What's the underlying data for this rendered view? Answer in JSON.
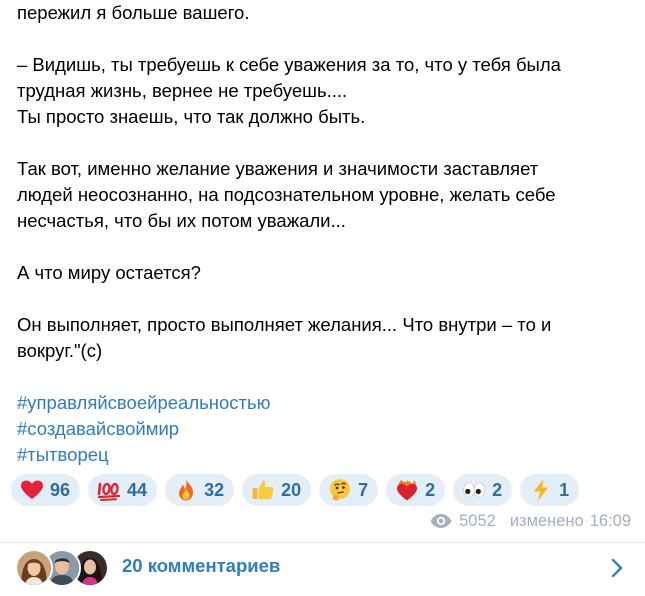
{
  "post": {
    "paragraphs": [
      [
        "пережил я больше вашего."
      ],
      [
        "– Видишь, ты требуешь к себе уважения за то, что у тебя была",
        "трудная жизнь, вернее не требуешь....",
        "Ты просто знаешь, что так должно быть."
      ],
      [
        "Так вот, именно желание уважения и значимости заставляет",
        "людей неосознанно, на подсознательном уровне, желать себе",
        "несчастья, что бы их потом уважали..."
      ],
      [
        "А что миру остается?"
      ],
      [
        "Он выполняет, просто выполняет желания... Что внутри – то и",
        "вокруг.\"(c)"
      ]
    ],
    "hashtags": [
      "#управляйсвоейреальностью",
      "#создавайсвоймир",
      "#тытворец"
    ]
  },
  "reactions": [
    {
      "icon": "heart-icon",
      "count": "96"
    },
    {
      "icon": "hundred-points-icon",
      "count": "44"
    },
    {
      "icon": "fire-icon",
      "count": "32"
    },
    {
      "icon": "thumbs-up-icon",
      "count": "20"
    },
    {
      "icon": "thinking-face-icon",
      "count": "7"
    },
    {
      "icon": "heart-on-fire-icon",
      "count": "2"
    },
    {
      "icon": "eyes-icon",
      "count": "2"
    },
    {
      "icon": "lightning-icon",
      "count": "1"
    }
  ],
  "meta": {
    "views": "5052",
    "edited_label": "изменено",
    "time": "16:09"
  },
  "comments": {
    "label": "20 комментариев"
  },
  "colors": {
    "link": "#2e7dc3",
    "reaction_bg": "#e4eef7",
    "reaction_text": "#2f6ea5",
    "meta_text": "#a3afbb"
  }
}
